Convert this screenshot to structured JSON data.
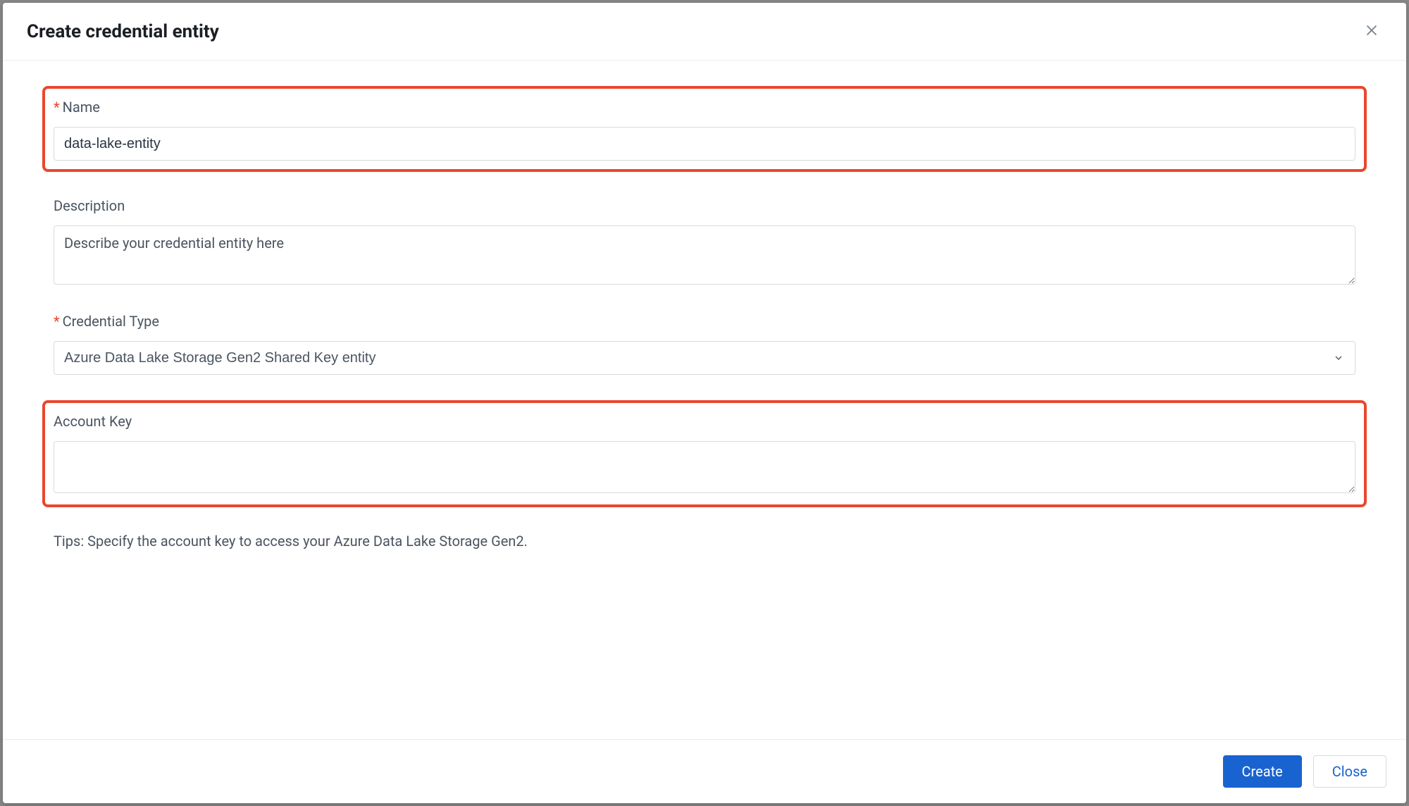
{
  "header": {
    "title": "Create credential entity"
  },
  "form": {
    "name": {
      "label": "Name",
      "value": "data-lake-entity"
    },
    "description": {
      "label": "Description",
      "placeholder": "Describe your credential entity here",
      "value": ""
    },
    "credential_type": {
      "label": "Credential Type",
      "value": "Azure Data Lake Storage Gen2 Shared Key entity"
    },
    "account_key": {
      "label": "Account Key",
      "value": "",
      "tips": "Tips: Specify the account key to access your Azure Data Lake Storage Gen2."
    }
  },
  "footer": {
    "create_label": "Create",
    "close_label": "Close"
  }
}
